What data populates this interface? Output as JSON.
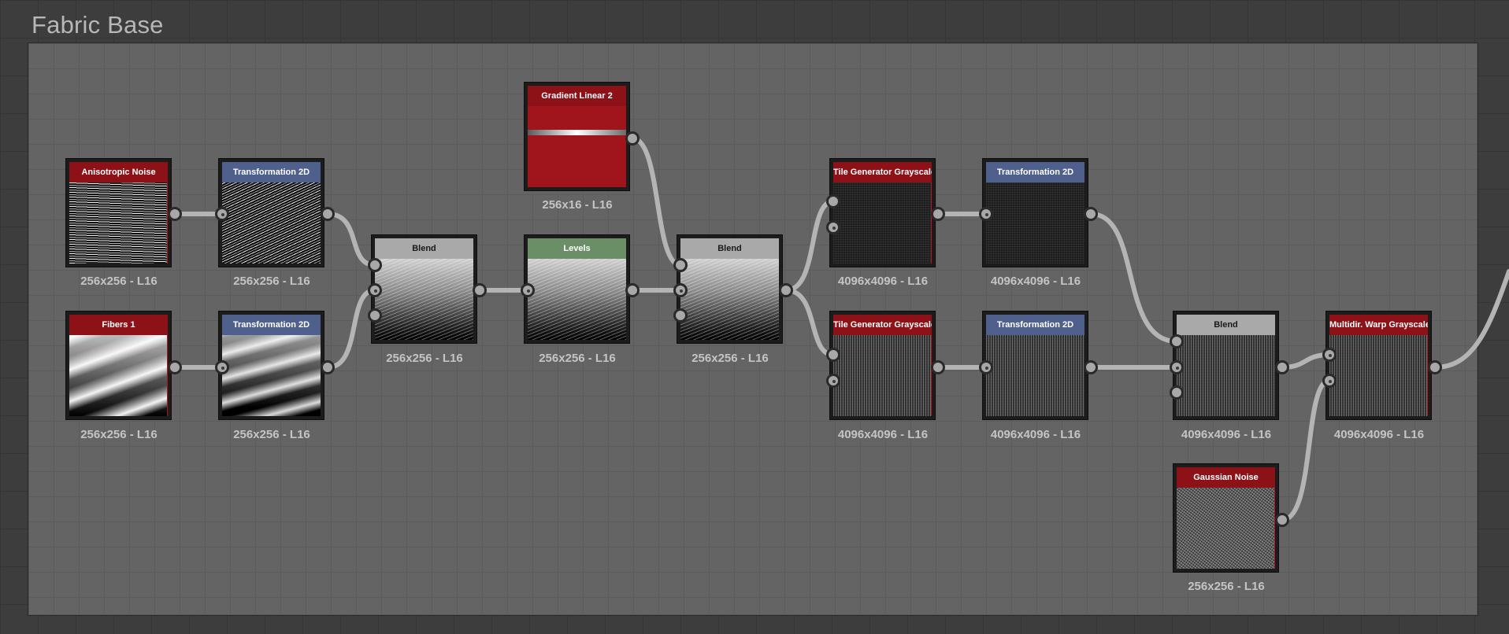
{
  "frame": {
    "title": "Fabric Base"
  },
  "nodes": [
    {
      "title": "Anisotropic Noise",
      "resolution": "256x256 - L16"
    },
    {
      "title": "Transformation 2D",
      "resolution": "256x256 - L16"
    },
    {
      "title": "Fibers 1",
      "resolution": "256x256 - L16"
    },
    {
      "title": "Transformation 2D",
      "resolution": "256x256 - L16"
    },
    {
      "title": "Blend",
      "resolution": "256x256 - L16"
    },
    {
      "title": "Gradient Linear 2",
      "resolution": "256x16 - L16"
    },
    {
      "title": "Levels",
      "resolution": "256x256 - L16"
    },
    {
      "title": "Blend",
      "resolution": "256x256 - L16"
    },
    {
      "title": "Tile Generator Grayscale",
      "resolution": "4096x4096 - L16"
    },
    {
      "title": "Transformation 2D",
      "resolution": "4096x4096 - L16"
    },
    {
      "title": "Tile Generator Grayscale",
      "resolution": "4096x4096 - L16"
    },
    {
      "title": "Transformation 2D",
      "resolution": "4096x4096 - L16"
    },
    {
      "title": "Blend",
      "resolution": "4096x4096 - L16"
    },
    {
      "title": "Multidir. Warp Grayscale",
      "resolution": "4096x4096 - L16"
    },
    {
      "title": "Gaussian Noise",
      "resolution": "256x256 - L16"
    }
  ],
  "colors": {
    "header_red": "#8c1218",
    "header_blue": "#4f608d",
    "header_gray": "#a9a9a9",
    "header_green": "#6a8f67",
    "wire": "#b4b4b4"
  }
}
